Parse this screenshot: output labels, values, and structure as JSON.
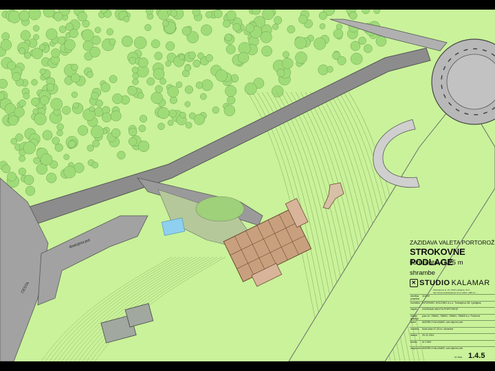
{
  "drawing": {
    "project": "ZAZIDAVA VALETA PORTOROŽ",
    "title": "STROKOVNE PODLAGE",
    "level": "tloris kota 47,25 m",
    "room": "shrambe"
  },
  "studio": {
    "name_bold": "STUDIO",
    "name_light": "KALAMAR",
    "address_lines": [
      "Kalamarova ul. 19, 1000 Ljubljana, SLO",
      "http://www.studiokalamar.com/ tel/fax +386 41 ..."
    ]
  },
  "title_block": [
    {
      "key": "stevilka projekta",
      "value": "110/09"
    },
    {
      "key": "investitor",
      "value": "INTERMEC HOLDING d.o.o. Trubarjeva 38, Ljubljana"
    },
    {
      "key": "objekt",
      "value": "ZAZIDAVA VALETA PORTOROŽ"
    },
    {
      "key": "mesto gradnje",
      "value": "parc.št. 7868/2, 7868/3, 7868/4, 7868/5 k.o. Portorož"
    },
    {
      "key": "avtor",
      "value": "ANDREJ KALAMAR, univ.dipl.inž.arh."
    },
    {
      "key": "vsebina",
      "value": "tloris kota 47,25 m, shrambe"
    },
    {
      "key": "datum",
      "value": "20.11.2011"
    },
    {
      "key": "merilo",
      "value": "M 1:500"
    },
    {
      "key": "odgovorni",
      "value": "ANDREJ KALAMAR, univ.dipl.inž.arh."
    }
  ],
  "sheet_label": "št. lista",
  "sheet_number": "1.4.5",
  "map_labels": {
    "road_left": "CESTA",
    "road_service": "dostopna pot"
  },
  "colors": {
    "terrain": "#c9f29a",
    "trees": "#9fdc78",
    "road": "#8c8c8c",
    "road_edge": "#555555",
    "building": "#c8a07e",
    "building_edge": "#6b4a30",
    "roundabout": "#b8b8b8",
    "contour": "#8fb36a",
    "water": "#8fd0f0"
  }
}
